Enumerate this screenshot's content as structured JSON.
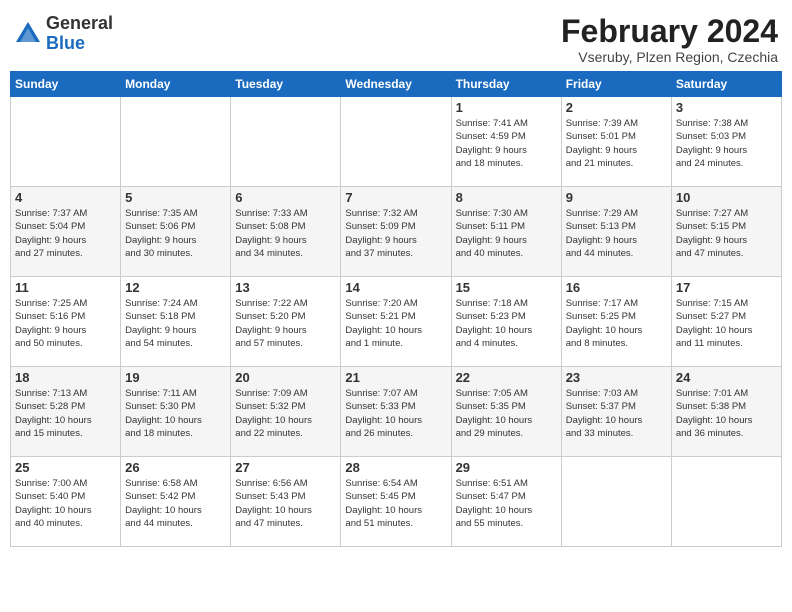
{
  "header": {
    "logo_general": "General",
    "logo_blue": "Blue",
    "month_title": "February 2024",
    "location": "Vseruby, Plzen Region, Czechia"
  },
  "weekdays": [
    "Sunday",
    "Monday",
    "Tuesday",
    "Wednesday",
    "Thursday",
    "Friday",
    "Saturday"
  ],
  "weeks": [
    [
      {
        "day": "",
        "info": ""
      },
      {
        "day": "",
        "info": ""
      },
      {
        "day": "",
        "info": ""
      },
      {
        "day": "",
        "info": ""
      },
      {
        "day": "1",
        "info": "Sunrise: 7:41 AM\nSunset: 4:59 PM\nDaylight: 9 hours\nand 18 minutes."
      },
      {
        "day": "2",
        "info": "Sunrise: 7:39 AM\nSunset: 5:01 PM\nDaylight: 9 hours\nand 21 minutes."
      },
      {
        "day": "3",
        "info": "Sunrise: 7:38 AM\nSunset: 5:03 PM\nDaylight: 9 hours\nand 24 minutes."
      }
    ],
    [
      {
        "day": "4",
        "info": "Sunrise: 7:37 AM\nSunset: 5:04 PM\nDaylight: 9 hours\nand 27 minutes."
      },
      {
        "day": "5",
        "info": "Sunrise: 7:35 AM\nSunset: 5:06 PM\nDaylight: 9 hours\nand 30 minutes."
      },
      {
        "day": "6",
        "info": "Sunrise: 7:33 AM\nSunset: 5:08 PM\nDaylight: 9 hours\nand 34 minutes."
      },
      {
        "day": "7",
        "info": "Sunrise: 7:32 AM\nSunset: 5:09 PM\nDaylight: 9 hours\nand 37 minutes."
      },
      {
        "day": "8",
        "info": "Sunrise: 7:30 AM\nSunset: 5:11 PM\nDaylight: 9 hours\nand 40 minutes."
      },
      {
        "day": "9",
        "info": "Sunrise: 7:29 AM\nSunset: 5:13 PM\nDaylight: 9 hours\nand 44 minutes."
      },
      {
        "day": "10",
        "info": "Sunrise: 7:27 AM\nSunset: 5:15 PM\nDaylight: 9 hours\nand 47 minutes."
      }
    ],
    [
      {
        "day": "11",
        "info": "Sunrise: 7:25 AM\nSunset: 5:16 PM\nDaylight: 9 hours\nand 50 minutes."
      },
      {
        "day": "12",
        "info": "Sunrise: 7:24 AM\nSunset: 5:18 PM\nDaylight: 9 hours\nand 54 minutes."
      },
      {
        "day": "13",
        "info": "Sunrise: 7:22 AM\nSunset: 5:20 PM\nDaylight: 9 hours\nand 57 minutes."
      },
      {
        "day": "14",
        "info": "Sunrise: 7:20 AM\nSunset: 5:21 PM\nDaylight: 10 hours\nand 1 minute."
      },
      {
        "day": "15",
        "info": "Sunrise: 7:18 AM\nSunset: 5:23 PM\nDaylight: 10 hours\nand 4 minutes."
      },
      {
        "day": "16",
        "info": "Sunrise: 7:17 AM\nSunset: 5:25 PM\nDaylight: 10 hours\nand 8 minutes."
      },
      {
        "day": "17",
        "info": "Sunrise: 7:15 AM\nSunset: 5:27 PM\nDaylight: 10 hours\nand 11 minutes."
      }
    ],
    [
      {
        "day": "18",
        "info": "Sunrise: 7:13 AM\nSunset: 5:28 PM\nDaylight: 10 hours\nand 15 minutes."
      },
      {
        "day": "19",
        "info": "Sunrise: 7:11 AM\nSunset: 5:30 PM\nDaylight: 10 hours\nand 18 minutes."
      },
      {
        "day": "20",
        "info": "Sunrise: 7:09 AM\nSunset: 5:32 PM\nDaylight: 10 hours\nand 22 minutes."
      },
      {
        "day": "21",
        "info": "Sunrise: 7:07 AM\nSunset: 5:33 PM\nDaylight: 10 hours\nand 26 minutes."
      },
      {
        "day": "22",
        "info": "Sunrise: 7:05 AM\nSunset: 5:35 PM\nDaylight: 10 hours\nand 29 minutes."
      },
      {
        "day": "23",
        "info": "Sunrise: 7:03 AM\nSunset: 5:37 PM\nDaylight: 10 hours\nand 33 minutes."
      },
      {
        "day": "24",
        "info": "Sunrise: 7:01 AM\nSunset: 5:38 PM\nDaylight: 10 hours\nand 36 minutes."
      }
    ],
    [
      {
        "day": "25",
        "info": "Sunrise: 7:00 AM\nSunset: 5:40 PM\nDaylight: 10 hours\nand 40 minutes."
      },
      {
        "day": "26",
        "info": "Sunrise: 6:58 AM\nSunset: 5:42 PM\nDaylight: 10 hours\nand 44 minutes."
      },
      {
        "day": "27",
        "info": "Sunrise: 6:56 AM\nSunset: 5:43 PM\nDaylight: 10 hours\nand 47 minutes."
      },
      {
        "day": "28",
        "info": "Sunrise: 6:54 AM\nSunset: 5:45 PM\nDaylight: 10 hours\nand 51 minutes."
      },
      {
        "day": "29",
        "info": "Sunrise: 6:51 AM\nSunset: 5:47 PM\nDaylight: 10 hours\nand 55 minutes."
      },
      {
        "day": "",
        "info": ""
      },
      {
        "day": "",
        "info": ""
      }
    ]
  ]
}
